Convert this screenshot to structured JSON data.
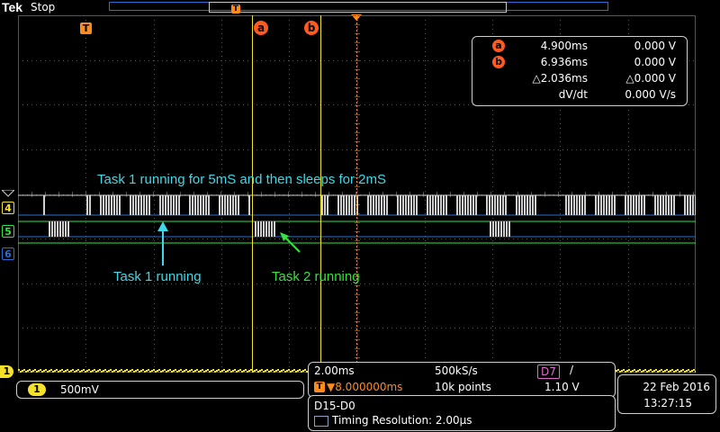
{
  "header": {
    "brand": "Tek",
    "status": "Stop",
    "trigger_marker": "T"
  },
  "markers": {
    "trigger": "T",
    "a": "a",
    "b": "b"
  },
  "cursor_readout": {
    "a": {
      "label": "a",
      "time": "4.900ms",
      "value": "0.000 V"
    },
    "b": {
      "label": "b",
      "time": "6.936ms",
      "value": "0.000 V"
    },
    "delta": {
      "time": "△2.036ms",
      "value": "△0.000 V"
    },
    "slope": {
      "label": "dV/dt",
      "value": "0.000 V/s"
    }
  },
  "annotations": {
    "headline": "Task 1 running for 5mS and then sleeps for 2mS",
    "task1": "Task 1 running",
    "task2": "Task 2 running"
  },
  "channels": {
    "digital": [
      {
        "label": "4",
        "color": "#f5e22a"
      },
      {
        "label": "5",
        "color": "#36e23c"
      },
      {
        "label": "6",
        "color": "#2a6fd6"
      }
    ],
    "analog_ch1_label": "1"
  },
  "colors": {
    "ch1": "#f5e22a",
    "ch4": "#d8d8d8",
    "ch5": "#36e23c",
    "ch6": "#2a6fd6",
    "cursor": "#f5e22a",
    "annot_cyan": "#3ed8e8",
    "annot_green": "#36e23c",
    "trigger": "#ff8c1a"
  },
  "bottom": {
    "ch1": {
      "number": "1",
      "scale": "500mV"
    },
    "horizontal": {
      "time_div": "2.00ms",
      "sample_rate": "500kS/s",
      "trigger_source": "D7",
      "trigger_slope": "/",
      "trigger_pos": "▼8.000000ms",
      "record_length": "10k points",
      "trigger_level": "1.10 V"
    },
    "digital": {
      "group": "D15-D0",
      "resolution": "Timing Resolution: 2.00µs"
    },
    "date": {
      "date": "22 Feb  2016",
      "time": "13:27:15"
    }
  }
}
